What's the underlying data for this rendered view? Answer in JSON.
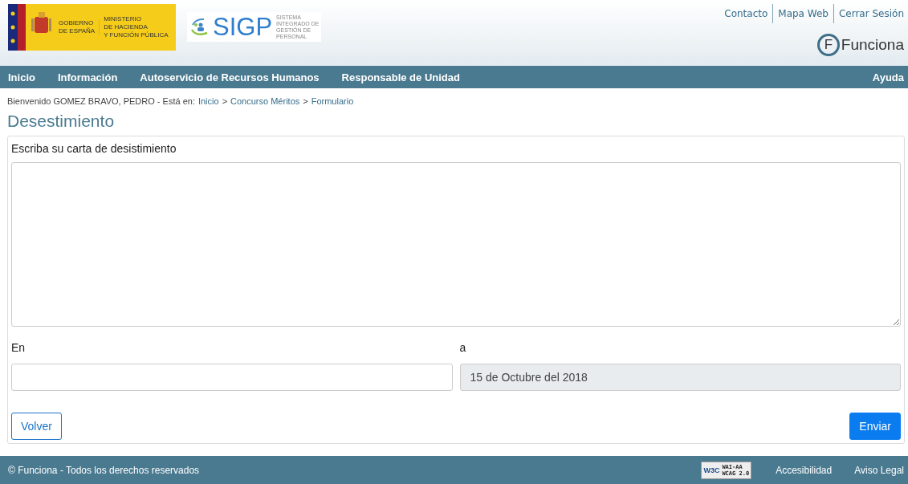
{
  "header": {
    "gov_logo": {
      "line_1": "GOBIERNO",
      "line_2": "DE ESPAÑA",
      "ministry_1": "MINISTERIO",
      "ministry_2": "DE HACIENDA",
      "ministry_3": "Y FUNCIÓN PÚBLICA"
    },
    "app_logo": {
      "name": "SIGP",
      "subtitle": [
        "SISTEMA",
        "INTEGRADO DE",
        "GESTIÓN DE",
        "PERSONAL"
      ]
    },
    "top_links": [
      "Contacto",
      "Mapa Web",
      "Cerrar Sesión"
    ],
    "brand": {
      "letter": "F",
      "name": "Funciona"
    }
  },
  "nav": {
    "items": [
      "Inicio",
      "Información",
      "Autoservicio de Recursos Humanos",
      "Responsable de Unidad"
    ],
    "help": "Ayuda"
  },
  "breadcrumb": {
    "welcome": "Bienvenido GOMEZ BRAVO, PEDRO - Está en:",
    "items": [
      "Inicio",
      "Concurso Méritos",
      "Formulario"
    ],
    "separator": ">"
  },
  "title": "Desestimiento",
  "form": {
    "letter_label": "Escriba su carta de desistimiento",
    "place_label": "En",
    "date_label": "a",
    "date_value": "15 de Octubre del 2018",
    "date_disabled": true,
    "back_button": "Volver",
    "send_button": "Enviar"
  },
  "footer": {
    "copyright": "© Funciona - Todos los derechos reservados",
    "badge": {
      "w3c": "W3C",
      "line_1": "WAI-AA",
      "line_2": "WCAG 2.0"
    },
    "links": [
      "Accesibilidad",
      "Aviso Legal"
    ]
  }
}
